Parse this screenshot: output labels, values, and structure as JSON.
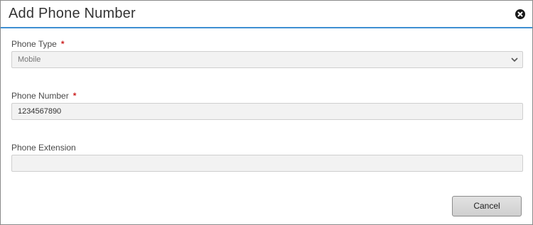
{
  "dialog": {
    "title": "Add Phone Number"
  },
  "fields": {
    "phone_type": {
      "label": "Phone Type",
      "required_marker": "*",
      "selected_value": "Mobile"
    },
    "phone_number": {
      "label": "Phone Number",
      "required_marker": "*",
      "value": "1234567890"
    },
    "phone_extension": {
      "label": "Phone Extension",
      "value": ""
    }
  },
  "buttons": {
    "cancel_label": "Cancel"
  },
  "icons": {
    "close": "close-icon",
    "chevron": "chevron-down-icon"
  },
  "colors": {
    "header_accent": "#3f8fd2",
    "required": "#cc2222"
  }
}
